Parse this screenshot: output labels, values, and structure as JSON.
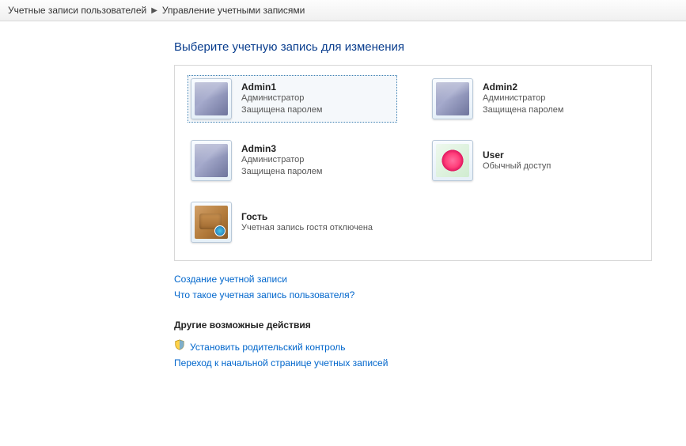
{
  "breadcrumb": {
    "level1": "Учетные записи пользователей",
    "level2": "Управление учетными записями"
  },
  "page_title": "Выберите учетную запись для изменения",
  "accounts": [
    {
      "name": "Admin1",
      "role": "Администратор",
      "status": "Защищена паролем",
      "avatar": "default",
      "selected": true
    },
    {
      "name": "Admin2",
      "role": "Администратор",
      "status": "Защищена паролем",
      "avatar": "default",
      "selected": false
    },
    {
      "name": "Admin3",
      "role": "Администратор",
      "status": "Защищена паролем",
      "avatar": "default",
      "selected": false
    },
    {
      "name": "User",
      "role": "Обычный доступ",
      "status": "",
      "avatar": "flower",
      "selected": false
    },
    {
      "name": "Гость",
      "role": "Учетная запись гостя отключена",
      "status": "",
      "avatar": "guest",
      "selected": false
    }
  ],
  "links": {
    "create_account": "Создание учетной записи",
    "what_is_account": "Что такое учетная запись пользователя?"
  },
  "other_section": {
    "heading": "Другие возможные действия",
    "parental": "Установить родительский контроль",
    "goto_main": "Переход к начальной странице учетных записей"
  }
}
